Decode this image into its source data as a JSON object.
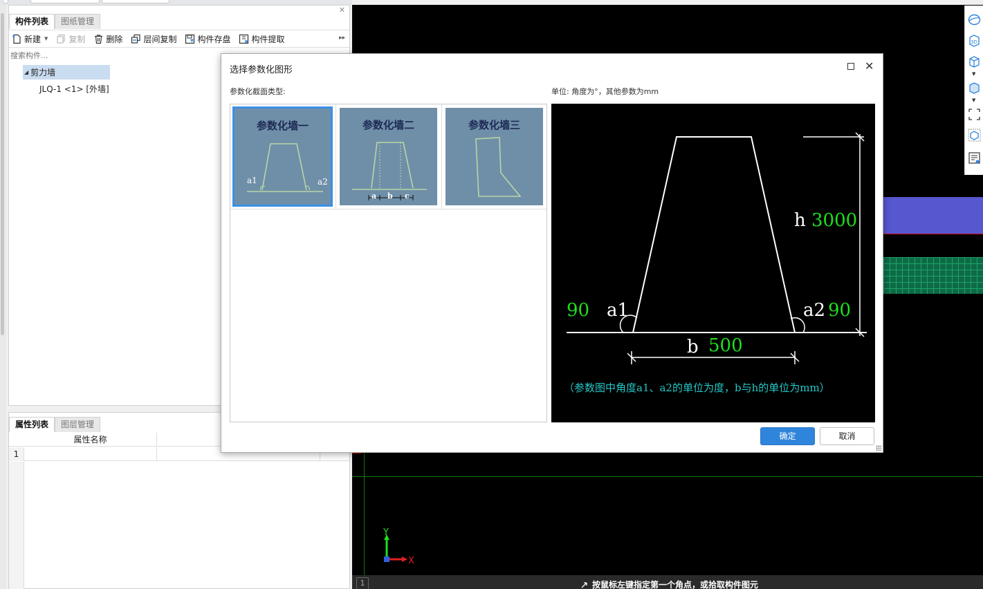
{
  "left_panel": {
    "tabs": [
      {
        "label": "构件列表",
        "active": true
      },
      {
        "label": "图纸管理",
        "active": false
      }
    ],
    "toolbar": {
      "new_label": "新建",
      "copy_label": "复制",
      "delete_label": "删除",
      "floor_copy_label": "层间复制",
      "save_label": "构件存盘",
      "extract_label": "构件提取"
    },
    "search": {
      "placeholder": "搜索构件..."
    },
    "tree": {
      "group": "剪力墙",
      "items": [
        "JLQ-1 <1> [外墙]"
      ]
    }
  },
  "property_panel": {
    "tabs": [
      {
        "label": "属性列表",
        "active": true
      },
      {
        "label": "图层管理",
        "active": false
      }
    ],
    "column_name": "属性名称",
    "row_number": "1"
  },
  "dialog": {
    "title": "选择参数化图形",
    "section_type_label": "参数化截面类型:",
    "unit_label": "单位:  角度为°，其他参数为mm",
    "shapes": [
      {
        "name": "参数化墙一",
        "selected": true
      },
      {
        "name": "参数化墙二",
        "selected": false
      },
      {
        "name": "参数化墙三",
        "selected": false
      }
    ],
    "thumb_labels": {
      "a1": "a1",
      "a2": "a2",
      "a": "a",
      "b": "b",
      "c": "c"
    },
    "preview": {
      "h_label": "h",
      "h_value": "3000",
      "a1_label": "a1",
      "a1_value": "90",
      "a2_label": "a2",
      "a2_value": "90",
      "b_label": "b",
      "b_value": "500",
      "note": "（参数图中角度a1、a2的单位为度，b与h的单位为mm）"
    },
    "ok_label": "确定",
    "cancel_label": "取消"
  },
  "canvas": {
    "axis_x": "X",
    "axis_y": "Y",
    "status_number": "1",
    "status_hint": "按鼠标左键指定第一个角点，或拾取构件图元"
  },
  "colors": {
    "accent": "#2f84db",
    "selection": "#3b8fe6",
    "thumb_bg": "#6f8fa8",
    "preview_value": "#1de01d",
    "preview_note": "#26c7c7"
  }
}
